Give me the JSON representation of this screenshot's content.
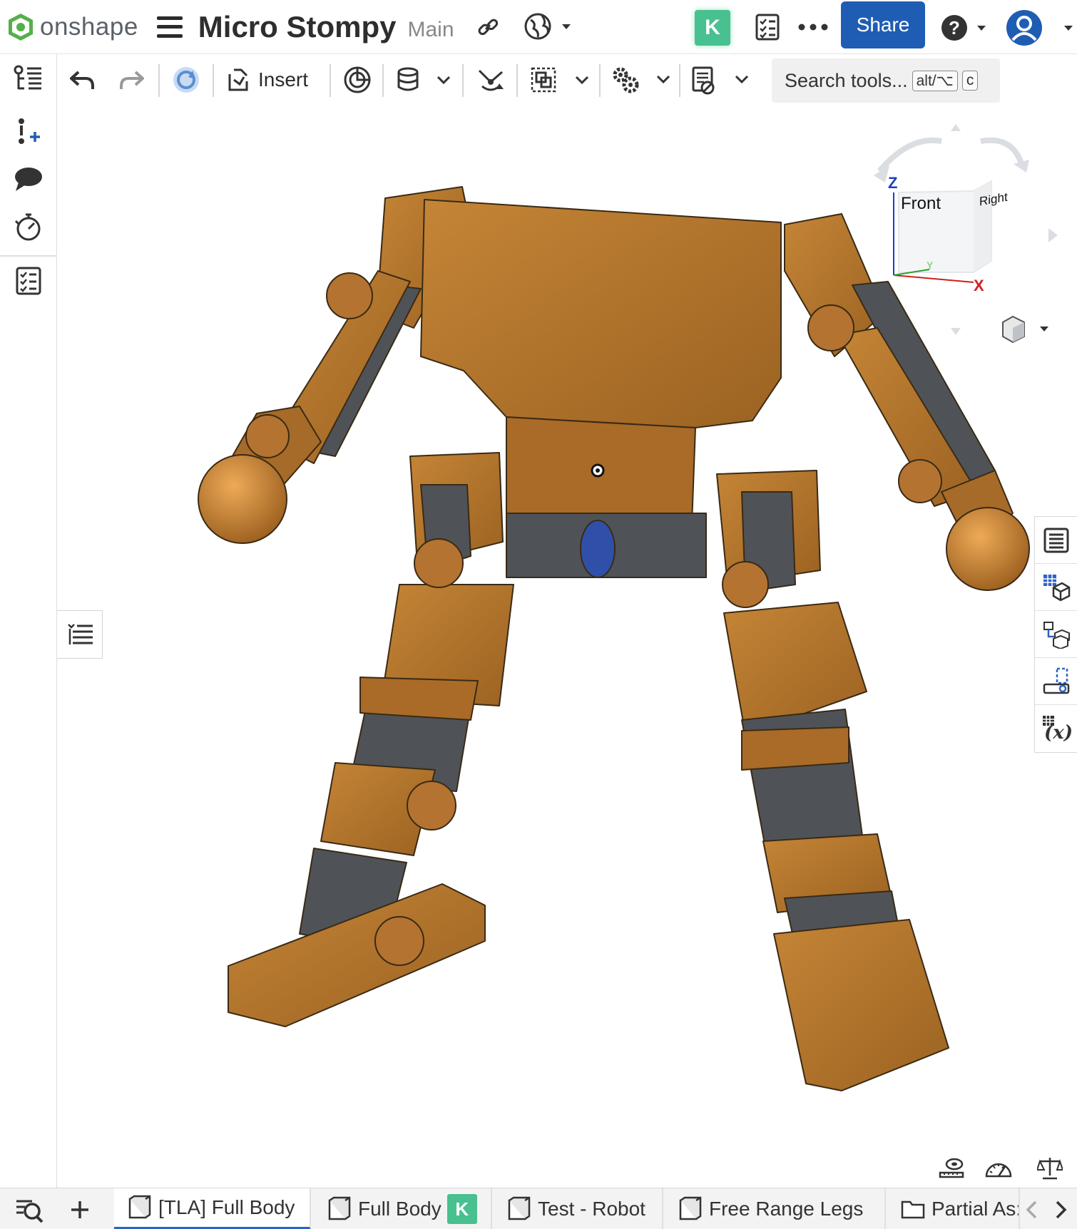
{
  "header": {
    "logo_text": "onshape",
    "doc_title": "Micro Stompy",
    "branch": "Main",
    "user_badge": "K",
    "share_label": "Share"
  },
  "toolbar": {
    "insert_label": "Insert",
    "search_placeholder": "Search tools...",
    "search_shortcut_1": "alt/⌥",
    "search_shortcut_2": "c"
  },
  "viewcube": {
    "front": "Front",
    "right": "Right",
    "axis_z": "Z",
    "axis_x": "X",
    "axis_y": "Y"
  },
  "tabs": [
    {
      "label": "[TLA] Full Body",
      "active": true
    },
    {
      "label": "Full Body",
      "badge": "K"
    },
    {
      "label": "Test - Robot"
    },
    {
      "label": "Free Range Legs"
    },
    {
      "label": "Partial As:"
    }
  ],
  "colors": {
    "brand_blue": "#1f5db4",
    "accent_green": "#48c08f",
    "part_orange": "#b8772e",
    "part_dark": "#565a60"
  }
}
